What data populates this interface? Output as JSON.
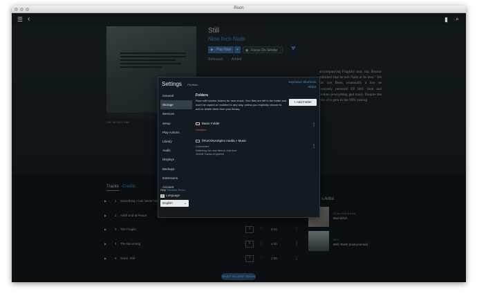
{
  "window": {
    "title": "Roon"
  },
  "album": {
    "title": "Still",
    "artist": "Nine Inch Nails",
    "play_now": "Play Now",
    "focus_similar": "Focus On Similar",
    "released_label": "Released",
    "added_label": "Added",
    "cover_caption": "Still, 44.1kHz 16bit",
    "review": "accompanying Fragility tour, ma, Reznor admitted that he nch Nails at its best.\" Yet the ave Been, essentially a live ne intensely personal EP Still. ieral and broken (everything ged man). Despite the mix of n gem in the NIN catalog."
  },
  "tabs": {
    "tracks": "Tracks",
    "credits": "Credits"
  },
  "tracks": [
    {
      "num": "1",
      "title": "Something I Can Never Have",
      "duration": "",
      "rating": ""
    },
    {
      "num": "2",
      "title": "Adrift and at Peace",
      "duration": "",
      "rating": ""
    },
    {
      "num": "3",
      "title": "The Fragile",
      "duration": "5:12",
      "rating": "Q"
    },
    {
      "num": "4",
      "title": "The Becoming",
      "duration": "4:30",
      "rating": "Q"
    },
    {
      "num": "5",
      "title": "Gone, Still",
      "duration": "2:36",
      "rating": "Q"
    }
  ],
  "sidebar": {
    "artist_header": "s Artist",
    "related": [
      {
        "meta": "31 Jan 2016 ★★★★",
        "title": "Bad Witch"
      },
      {
        "meta": "2013",
        "title": "With Teeth (Instrumental)"
      }
    ]
  },
  "select_button": "SELECT MULTIPLE TRACKS",
  "settings": {
    "title": "Settings",
    "subtitle": "PlexMac",
    "keyboard_shortcuts": "Keyboard Shortcuts",
    "about": "About",
    "nav": [
      "General",
      "Storage",
      "Services",
      "Setup",
      "Play Actions",
      "Library",
      "Audio",
      "Displays",
      "Backups",
      "Extensions",
      "Account"
    ],
    "help_text": "Help",
    "help_link": "Translate Roon!",
    "language_label": "Language",
    "language_value": "English",
    "folders_header": "Folders",
    "add_folder": "Add Folder",
    "description": "Roon will monitor folders for new music. Your files are left in the folder and won't be copied or modified in any way, unless you explicitly choose to add or delete them from your library.",
    "folders": [
      {
        "name": "Music Folder",
        "status": "Disabled"
      },
      {
        "name": "\\\\PLEX\\NAS\\plex media > Music",
        "status": "Connected\nWatching for new files in real time\n26408 Tracks Imported"
      }
    ]
  },
  "colors": {
    "accent": "#4f8bc6",
    "background": "#141a1e",
    "disabled": "#d7563d"
  }
}
